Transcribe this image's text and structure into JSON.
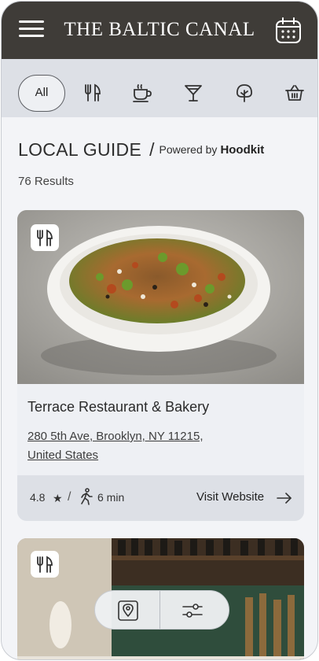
{
  "header": {
    "brand": "THE BALTIC CANAL",
    "menu_icon": "hamburger-menu-icon",
    "calendar_icon": "calendar-icon"
  },
  "categories": {
    "all_label": "All",
    "icons": [
      "fork-knife-icon",
      "coffee-cup-icon",
      "cocktail-icon",
      "tree-icon",
      "basket-icon"
    ]
  },
  "guide": {
    "title": "LOCAL GUIDE",
    "slash": "/",
    "powered_by": "Powered by",
    "provider": "Hoodkit",
    "results": "76 Results"
  },
  "cards": [
    {
      "category_icon": "fork-knife-icon",
      "name": "Terrace Restaurant & Bakery",
      "address": "280 5th Ave, Brooklyn, NY 11215, United States",
      "rating": "4.8",
      "star": "★",
      "separator": "/",
      "walk_time": "6 min",
      "visit_label": "Visit Website"
    },
    {
      "category_icon": "fork-knife-icon"
    }
  ],
  "floating_bar": {
    "map_icon": "map-pin-icon",
    "filter_icon": "sliders-filter-icon"
  },
  "colors": {
    "header_bg": "#3f3c38",
    "category_bar_bg": "#dde0e6",
    "page_bg": "#f3f4f7",
    "card_footer_bg": "#dde0e6"
  }
}
